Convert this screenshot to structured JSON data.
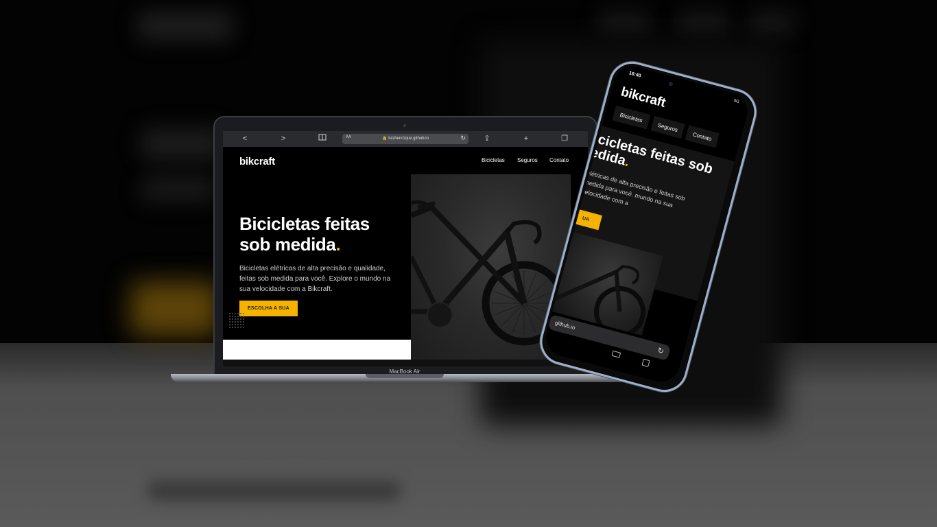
{
  "laptop": {
    "browser": {
      "back": "<",
      "forward": ">",
      "reader_icon": "book-icon",
      "url_aa": "AA",
      "url": "🔒 luizhenr1que.github.io",
      "reload": "↻",
      "share": "⇪",
      "new_tab": "+",
      "tabs": "❐"
    },
    "site": {
      "logo": "bikcraft",
      "nav": [
        "Bicicletas",
        "Seguros",
        "Contato"
      ],
      "hero_title": "Bicicletas feitas sob medida",
      "hero_dot": ".",
      "hero_text": "Bicicletas elétricas de alta precisão e qualidade, feitas sob medida para você. Explore o mundo na sua velocidade com a Bikcraft.",
      "cta": "ESCOLHA A SUA"
    },
    "label": "MacBook Air"
  },
  "phone": {
    "time": "16:40",
    "status": "5G",
    "logo": "bikcraft",
    "tabs": [
      "Bicicletas",
      "Seguros",
      "Contato"
    ],
    "hero_title_1": "icicletas feitas sob",
    "hero_title_2": "edida",
    "hero_dot": ".",
    "hero_text": "elétricas de alta precisão e feitas sob medida para você. mundo na sua velocidade com a",
    "cta": "UA",
    "url": "github.io",
    "reload": "↻"
  },
  "colors": {
    "accent": "#f5b300",
    "background": "#000000"
  }
}
